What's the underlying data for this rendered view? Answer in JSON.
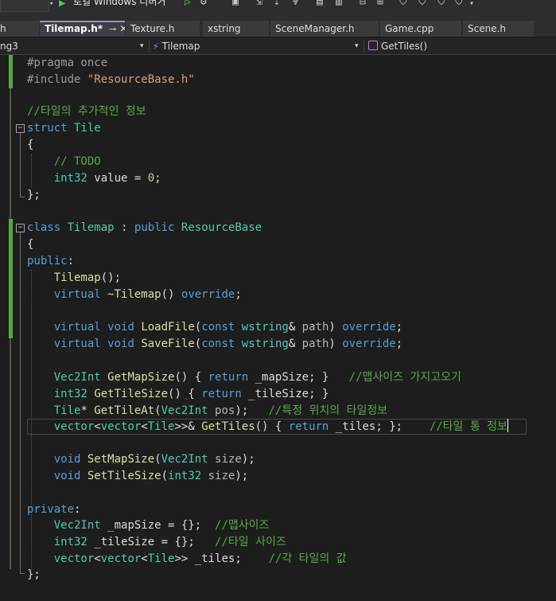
{
  "toolbar": {
    "run_target": "로컬 Windows 디버거",
    "config": ""
  },
  "tabs": [
    {
      "label": "h"
    },
    {
      "label": "Tilemap.h*",
      "active": true
    },
    {
      "label": "Texture.h"
    },
    {
      "label": "xstring"
    },
    {
      "label": "SceneManager.h"
    },
    {
      "label": "Game.cpp"
    },
    {
      "label": "Scene.h"
    }
  ],
  "navbar": {
    "project": "ng3",
    "scope": "Tilemap",
    "member": "GetTiles()"
  },
  "code": {
    "l01": "#pragma once",
    "l02_a": "#include ",
    "l02_b": "\"ResourceBase.h\"",
    "l04": "//타일의 추가적인 정보",
    "l05_kw": "struct",
    "l05_ty": "Tile",
    "l06": "{",
    "l07": "// TODO",
    "l08_ty": "int32",
    "l08_rest": " value = ",
    "l08_num": "0",
    "l08_end": ";",
    "l09": "};",
    "l11_kw1": "class",
    "l11_ty": "Tilemap",
    "l11_mid": " : ",
    "l11_kw2": "public",
    "l11_base": "ResourceBase",
    "l12": "{",
    "l13_kw": "public",
    "l13_end": ":",
    "l14_fn": "Tilemap",
    "l14_end": "();",
    "l15_kw": "virtual",
    "l15_fn": " ~Tilemap",
    "l15_mid": "() ",
    "l15_kw2": "override",
    "l15_end": ";",
    "l17_kw1": "virtual",
    "l17_kw2": "void",
    "l17_fn": "LoadFile",
    "l17_p1": "(",
    "l17_kw3": "const",
    "l17_ty": "wstring",
    "l17_amp": "& ",
    "l17_par": "path",
    "l17_p2": ") ",
    "l17_kw4": "override",
    "l17_end": ";",
    "l18_fn": "SaveFile",
    "l20_ty": "Vec2Int",
    "l20_fn": "GetMapSize",
    "l20_a": "() { ",
    "l20_kw": "return",
    "l20_mem": " _mapSize",
    "l20_b": "; }",
    "l20_cm": "//맵사이즈 가지고오기",
    "l21_ty": "int32",
    "l21_fn": "GetTileSize",
    "l21_mem": " _tileSize",
    "l22_ty": "Tile",
    "l22_star": "* ",
    "l22_fn": "GetTileAt",
    "l22_p1": "(",
    "l22_ty2": "Vec2Int",
    "l22_par": " pos",
    "l22_p2": ");",
    "l22_cm": "//특정 위치의 타일정보",
    "l23_ty1": "vector",
    "l23_lt": "<",
    "l23_ty2": "vector",
    "l23_ty3": "Tile",
    "l23_gt": ">>& ",
    "l23_fn": "GetTiles",
    "l23_mem": " _tiles",
    "l23_b": "; };",
    "l23_cm": "//타일 통 정보",
    "l25_kw": "void",
    "l25_fn": "SetMapSize",
    "l25_par": " size",
    "l25_end": ");",
    "l26_fn": "SetTileSize",
    "l26_ty": "int32",
    "l28_kw": "private",
    "l29_ty": "Vec2Int",
    "l29_mem": " _mapSize",
    "l29_mid": " = {};",
    "l29_cm": "//맵사이즈",
    "l30_ty": "int32",
    "l30_mem": " _tileSize",
    "l30_cm": "//타일 사이즈",
    "l31_mem": " _tiles",
    "l31_end": ";",
    "l31_cm": "//각 타일의 값",
    "l32": "};"
  }
}
